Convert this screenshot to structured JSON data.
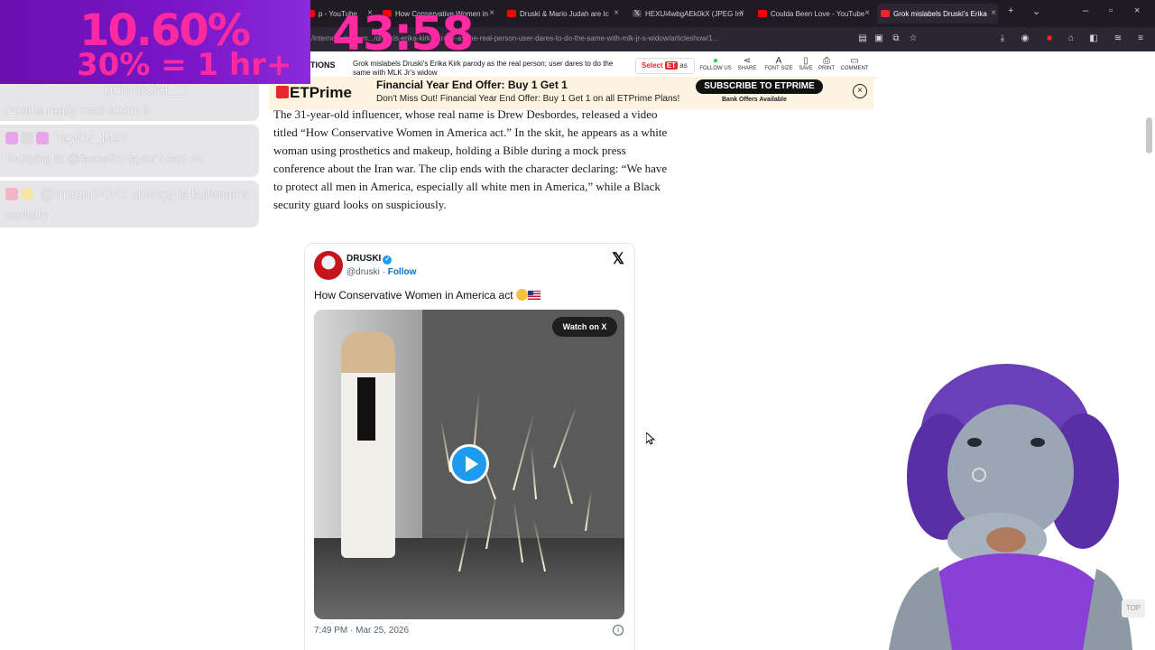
{
  "browser": {
    "tabs": [
      {
        "label": "p - YouTube",
        "active": false,
        "favicon": "youtube"
      },
      {
        "label": "How Conservative Women in",
        "active": false,
        "favicon": "youtube"
      },
      {
        "label": "Druski & Mario Judah are Ic",
        "active": false,
        "favicon": "youtube"
      },
      {
        "label": "HEXUi4wbgAEk0kX (JPEG Im",
        "active": false,
        "favicon": "x"
      },
      {
        "label": "Coulda Been Love - YouTube",
        "active": false,
        "favicon": "youtube"
      },
      {
        "label": "Grok mislabels Druski's Erika",
        "active": true,
        "favicon": "et"
      }
    ],
    "url": "/interne/.../grok-m.../druskis-erika-kirk-parody-as-the-real-person-user-dares-to-do-the-same-with-mlk-jr-s-widow/articleshow/1..."
  },
  "overlay": {
    "percent": "10.60%",
    "rate": "30% = 1 hr+",
    "clock": "43:58"
  },
  "site": {
    "section": "TIONS",
    "headline": "Grok mislabels Druski's Erika Kirk parody as the real person; user dares to do the same with MLK Jr's widow",
    "select_label": "Select",
    "select_suffix": "as",
    "actions": [
      {
        "label": "FOLLOW US",
        "icon": "whatsapp-icon",
        "glyph": "●"
      },
      {
        "label": "SHARE",
        "icon": "share-icon",
        "glyph": "⋖"
      },
      {
        "label": "FONT SIZE",
        "icon": "font-size-icon",
        "glyph": "A"
      },
      {
        "label": "SAVE",
        "icon": "bookmark-icon",
        "glyph": "▯"
      },
      {
        "label": "PRINT",
        "icon": "print-icon",
        "glyph": "⎙"
      },
      {
        "label": "COMMENT",
        "icon": "comment-icon",
        "glyph": "▭"
      }
    ]
  },
  "prime": {
    "logo": "ETPrime",
    "title": "Financial Year End Offer: Buy 1 Get 1",
    "desc": "Don't Miss Out! Financial Year End Offer: Buy 1 Get 1 on all ETPrime Plans!",
    "subscribe": "SUBSCRIBE TO ETPRIME",
    "offers": "Bank Offers Available"
  },
  "article": {
    "paragraph": "The 31-year-old influencer, whose real name is Drew Desbordes, released a video titled “How Conservative Women in America act.” In the skit, he appears as a white woman using prosthetics and makeup, holding a Bible during a mock press conference about the Iran war. The clip ends with the character declaring: “We have to protect all men in America, especially all white men in America,” while a Black security guard looks on suspiciously."
  },
  "tweet": {
    "name": "DRUSKI",
    "handle": "@druski",
    "follow": "Follow",
    "text": "How Conservative Women in America act",
    "watch_label": "Watch on X",
    "timestamp": "7:49 PM · Mar 25, 2026"
  },
  "chat": [
    {
      "user": "primordial__:",
      "message": "Pool is really mad about it",
      "reply": ""
    },
    {
      "user": "Taylor_M9:",
      "reply": "Replying to @faenefio: taylor i cant rn.",
      "message": ""
    },
    {
      "user": "@moon0-0-0:",
      "message": "chleepy is kuihman's territory",
      "reply": ""
    }
  ],
  "misc": {
    "scroll_top": "TOP"
  },
  "colors": {
    "timer_pink": "#ff2aa0",
    "overlay_purple": "#7a16c8",
    "et_red": "#e8262d",
    "prime_bg": "#fdf3df",
    "x_blue": "#1d9bf0"
  }
}
